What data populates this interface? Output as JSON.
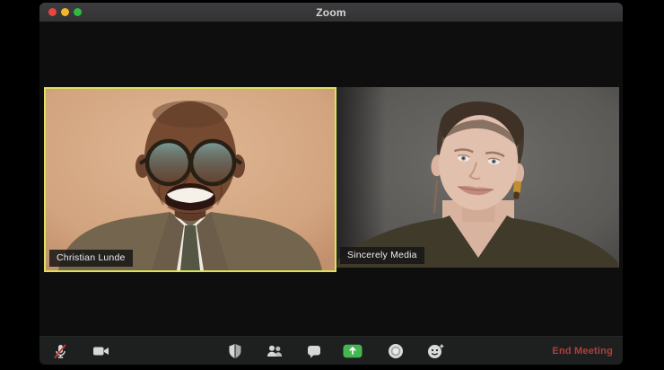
{
  "window": {
    "title": "Zoom",
    "traffic_lights": [
      {
        "name": "close",
        "color": "#e8463f"
      },
      {
        "name": "minimize",
        "color": "#f2b52c"
      },
      {
        "name": "fullscreen",
        "color": "#2fba44"
      }
    ]
  },
  "participants": [
    {
      "name": "Christian Lunde",
      "active_speaker": true,
      "video_description": "smiling man, shaved head, round glasses, tweed jacket and tie, warm tan background"
    },
    {
      "name": "Sincerely Media",
      "active_speaker": false,
      "video_description": "woman with buzzed hair, amber earring, dark olive v-neck top, gray background"
    }
  ],
  "toolbar": {
    "buttons": [
      {
        "icon": "microphone-muted-icon",
        "state": "muted"
      },
      {
        "icon": "video-camera-icon",
        "state": "on"
      },
      {
        "icon": "security-shield-icon"
      },
      {
        "icon": "participants-icon"
      },
      {
        "icon": "chat-icon"
      },
      {
        "icon": "share-screen-icon",
        "accent": "#45b654"
      },
      {
        "icon": "record-icon"
      },
      {
        "icon": "reactions-icon"
      }
    ],
    "end_meeting_label": "End Meeting"
  },
  "colors": {
    "active_speaker_border": "#d9e35b",
    "end_meeting_red": "#b0403a",
    "share_screen_green": "#45b654",
    "titlebar_bg": "#38383a",
    "toolbar_bg": "#1e2020",
    "muted_slash_red": "#c8403a"
  }
}
